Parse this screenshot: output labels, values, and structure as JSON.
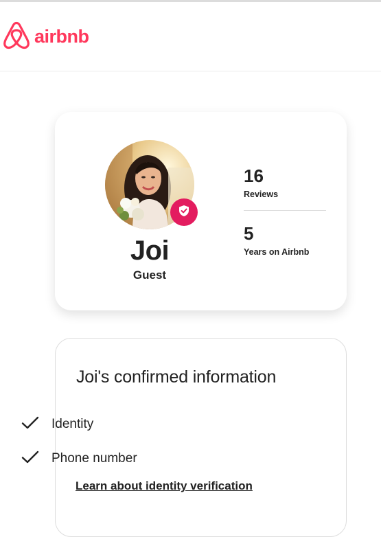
{
  "brand": {
    "name": "airbnb",
    "color": "#ff385c",
    "logo_icon": "airbnb-belo-icon"
  },
  "profile": {
    "name": "Joi",
    "role": "Guest",
    "verified_badge_color": "#e31c5f",
    "verified_icon": "shield-check-icon",
    "stats": [
      {
        "value": "16",
        "label": "Reviews"
      },
      {
        "value": "5",
        "label": "Years on Airbnb"
      }
    ]
  },
  "confirmed": {
    "title": "Joi's confirmed information",
    "items": [
      {
        "label": "Identity",
        "icon": "checkmark-icon"
      },
      {
        "label": "Phone number",
        "icon": "checkmark-icon"
      }
    ],
    "link": "Learn about identity verification"
  }
}
